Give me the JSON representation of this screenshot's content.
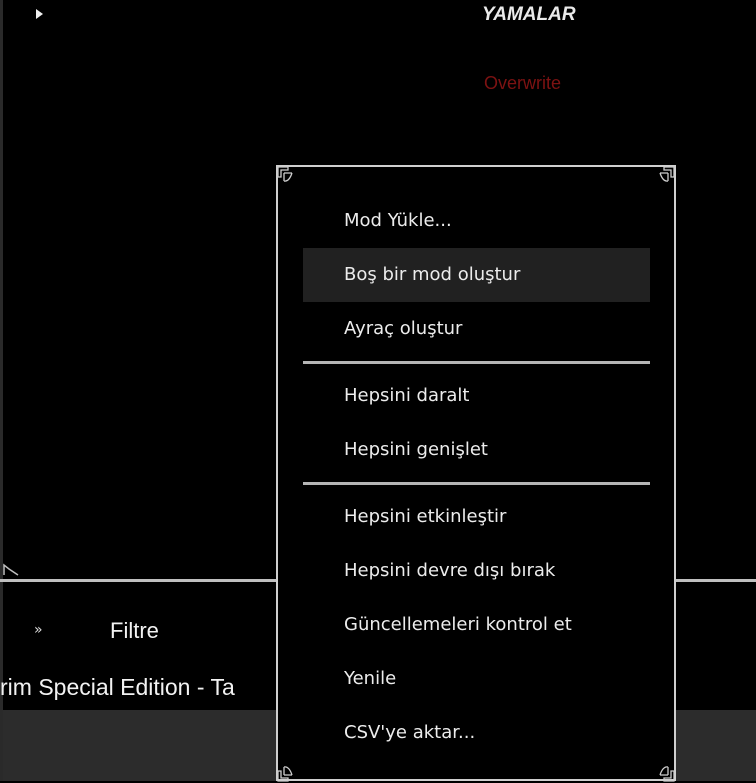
{
  "background": {
    "column_title": "YAMALAR",
    "overwrite_label": "Overwrite",
    "filter_label": "Filtre",
    "filter_chevron": "»",
    "bottom_text": "rim Special Edition - Ta"
  },
  "context_menu": {
    "items": [
      {
        "label": "Mod Yükle..."
      },
      {
        "label": "Boş bir mod oluştur",
        "highlighted": true
      },
      {
        "label": "Ayraç oluştur"
      },
      {
        "separator": true
      },
      {
        "label": "Hepsini daralt"
      },
      {
        "label": "Hepsini genişlet"
      },
      {
        "separator": true
      },
      {
        "label": "Hepsini etkinleştir"
      },
      {
        "label": "Hepsini devre dışı bırak"
      },
      {
        "label": "Güncellemeleri kontrol et"
      },
      {
        "label": "Yenile"
      },
      {
        "label": "CSV'ye aktar..."
      }
    ]
  },
  "colors": {
    "overwrite": "#7d1212",
    "highlight": "#212121",
    "border": "#cfcfcf"
  }
}
